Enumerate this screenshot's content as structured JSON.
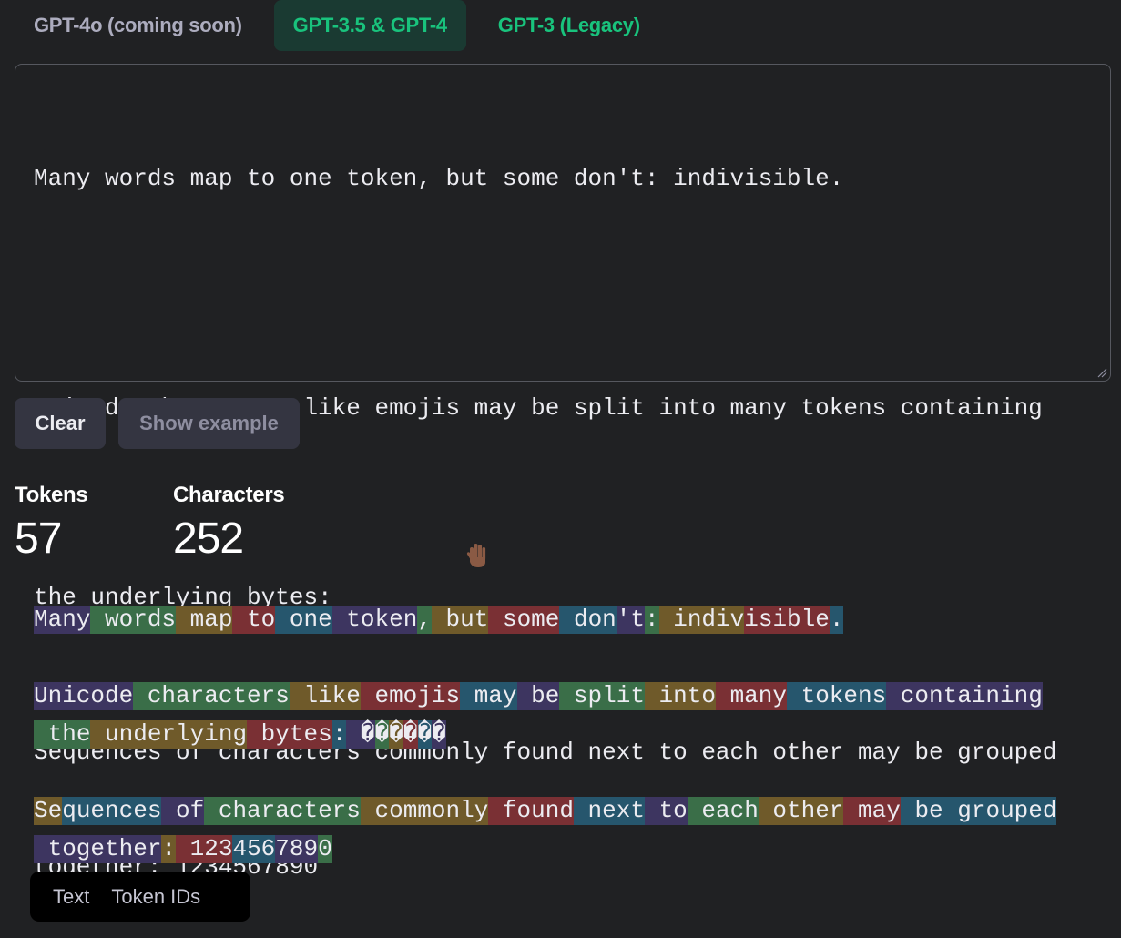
{
  "tabs": [
    {
      "label": "GPT-4o (coming soon)",
      "state": "disabled"
    },
    {
      "label": "GPT-3.5 & GPT-4",
      "state": "active"
    },
    {
      "label": "GPT-3 (Legacy)",
      "state": "inactive"
    }
  ],
  "input": {
    "lines": [
      "Many words map to one token, but some don't: indivisible.",
      "",
      "Unicode characters like emojis may be split into many tokens containing",
      "the underlying bytes: ",
      "",
      "Sequences of characters commonly found next to each other may be grouped",
      "together: 1234567890"
    ],
    "emoji": "✋🏾"
  },
  "buttons": {
    "clear": "Clear",
    "show_example": "Show example"
  },
  "stats": {
    "tokens_label": "Tokens",
    "tokens_value": "57",
    "characters_label": "Characters",
    "characters_value": "252"
  },
  "token_lines": [
    [
      [
        "Many",
        0
      ],
      [
        " words",
        1
      ],
      [
        " map",
        2
      ],
      [
        " to",
        3
      ],
      [
        " one",
        4
      ],
      [
        " token",
        0
      ],
      [
        ",",
        1
      ],
      [
        " but",
        2
      ],
      [
        " some",
        3
      ],
      [
        " don",
        4
      ],
      [
        "'t",
        0
      ],
      [
        ":",
        1
      ],
      [
        " indiv",
        2
      ],
      [
        "isible",
        3
      ],
      [
        ".",
        4
      ]
    ],
    [],
    [
      [
        "Unicode",
        0
      ],
      [
        " characters",
        1
      ],
      [
        " like",
        2
      ],
      [
        " emojis",
        3
      ],
      [
        " may",
        4
      ],
      [
        " be",
        0
      ],
      [
        " split",
        1
      ],
      [
        " into",
        2
      ],
      [
        " many",
        3
      ],
      [
        " tokens",
        4
      ],
      [
        " containing",
        0
      ]
    ],
    [
      [
        " ",
        1
      ],
      [
        "the",
        1
      ],
      [
        " underlying",
        2
      ],
      [
        " bytes",
        3
      ],
      [
        ":",
        4
      ],
      [
        " ",
        0
      ],
      [
        "�",
        0
      ],
      [
        "�",
        1
      ],
      [
        "�",
        2
      ],
      [
        "�",
        3
      ],
      [
        "�",
        4
      ],
      [
        "�",
        0
      ]
    ],
    [],
    [
      [
        "Se",
        2
      ],
      [
        "quences",
        4
      ],
      [
        " of",
        0
      ],
      [
        " characters",
        1
      ],
      [
        " commonly",
        2
      ],
      [
        " found",
        3
      ],
      [
        " next",
        4
      ],
      [
        " to",
        0
      ],
      [
        " each",
        1
      ],
      [
        " other",
        2
      ],
      [
        " may",
        3
      ],
      [
        " be",
        4
      ],
      [
        " grouped",
        4
      ]
    ],
    [
      [
        " together",
        0
      ],
      [
        ":",
        2
      ],
      [
        " ",
        3
      ],
      [
        "123",
        3
      ],
      [
        "456",
        4
      ],
      [
        "789",
        0
      ],
      [
        "0",
        1
      ]
    ]
  ],
  "view_toggle": {
    "text": "Text",
    "token_ids": "Token IDs"
  }
}
